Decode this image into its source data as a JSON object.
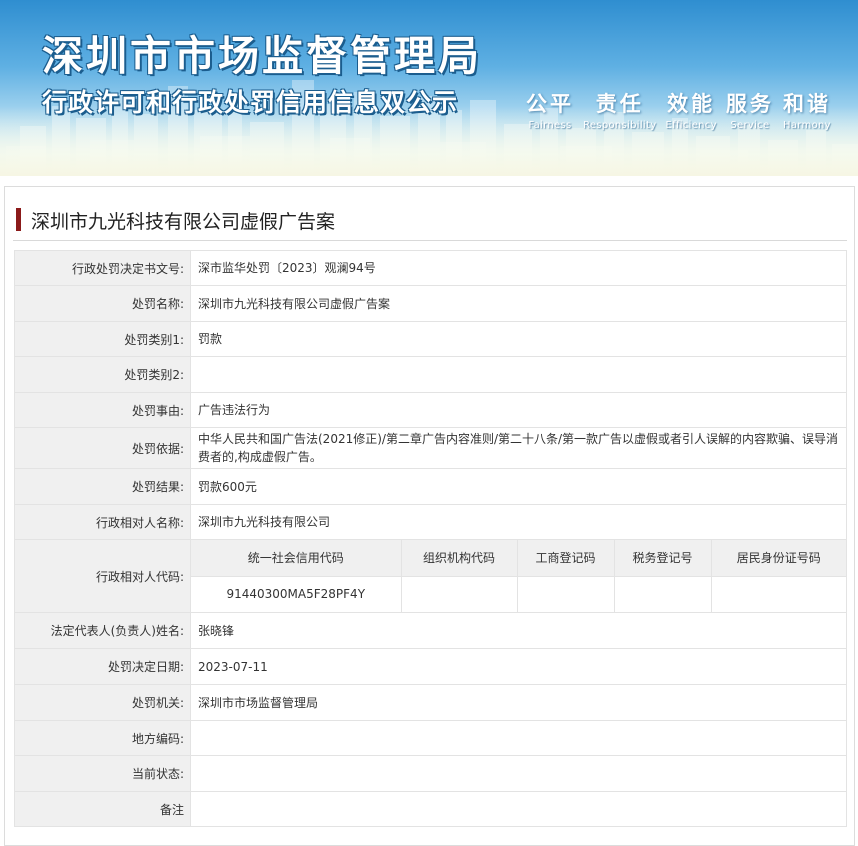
{
  "banner": {
    "title": "深圳市市场监督管理局",
    "subtitle": "行政许可和行政处罚信用信息双公示",
    "slogans": [
      {
        "zh": "公平",
        "en": "Fairness"
      },
      {
        "zh": "责任",
        "en": "Responsibility"
      },
      {
        "zh": "效能",
        "en": "Efficiency"
      },
      {
        "zh": "服务",
        "en": "Service"
      },
      {
        "zh": "和谐",
        "en": "Harmony"
      }
    ]
  },
  "case": {
    "title": "深圳市九光科技有限公司虚假广告案"
  },
  "rows": {
    "decision_number": {
      "label": "行政处罚决定书文号:",
      "value": "深市监华处罚〔2023〕观澜94号"
    },
    "penalty_name": {
      "label": "处罚名称:",
      "value": "深圳市九光科技有限公司虚假广告案"
    },
    "penalty_type1": {
      "label": "处罚类别1:",
      "value": "罚款"
    },
    "penalty_type2": {
      "label": "处罚类别2:",
      "value": ""
    },
    "penalty_reason": {
      "label": "处罚事由:",
      "value": "广告违法行为"
    },
    "penalty_basis": {
      "label": "处罚依据:",
      "value": "中华人民共和国广告法(2021修正)/第二章广告内容准则/第二十八条/第一款广告以虚假或者引人误解的内容欺骗、误导消费者的,构成虚假广告。"
    },
    "penalty_result": {
      "label": "处罚结果:",
      "value": "罚款600元"
    },
    "counterparty_name": {
      "label": "行政相对人名称:",
      "value": "深圳市九光科技有限公司"
    },
    "counterparty_code": {
      "label": "行政相对人代码:",
      "headers": [
        "统一社会信用代码",
        "组织机构代码",
        "工商登记码",
        "税务登记号",
        "居民身份证号码"
      ],
      "values": [
        "91440300MA5F28PF4Y",
        "",
        "",
        "",
        ""
      ]
    },
    "legal_rep": {
      "label": "法定代表人(负责人)姓名:",
      "value": "张晓锋"
    },
    "decision_date": {
      "label": "处罚决定日期:",
      "value": "2023-07-11"
    },
    "authority": {
      "label": "处罚机关:",
      "value": "深圳市市场监督管理局"
    },
    "local_code": {
      "label": "地方编码:",
      "value": ""
    },
    "current_status": {
      "label": "当前状态:",
      "value": ""
    },
    "remarks": {
      "label": "备注",
      "value": ""
    }
  }
}
